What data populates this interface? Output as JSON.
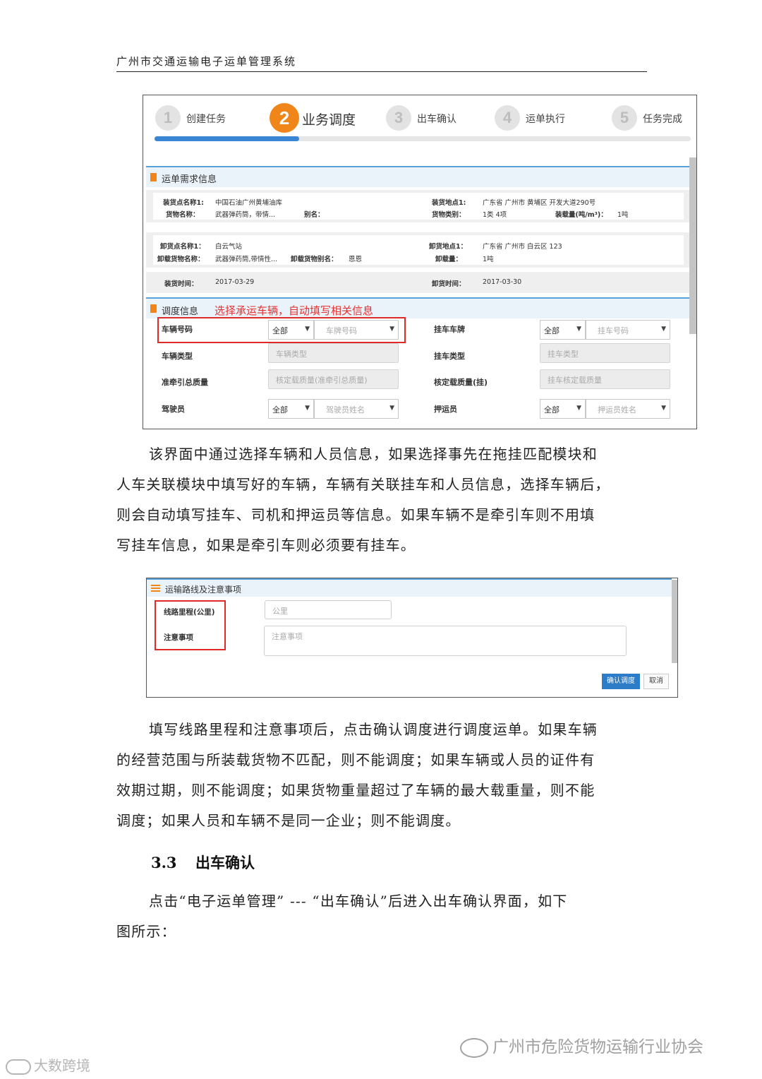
{
  "header": {
    "title": "广州市交通运输电子运单管理系统"
  },
  "screenshot1": {
    "steps": [
      {
        "num": "1",
        "label": "创建任务"
      },
      {
        "num": "2",
        "label": "业务调度"
      },
      {
        "num": "3",
        "label": "出车确认"
      },
      {
        "num": "4",
        "label": "运单执行"
      },
      {
        "num": "5",
        "label": "任务完成"
      }
    ],
    "progress_fraction": 0.27,
    "demand_section_title": "运单需求信息",
    "loading": {
      "name_label": "装货点名称1:",
      "name_value": "中国石油广州黄埔油库",
      "cargo_label": "货物名称：",
      "cargo_value": "武器弹药筒，带情...",
      "alias_label": "别名：",
      "place_label": "装货地点1:",
      "place_value": "广东省 广州市 黄埔区 开发大道290号",
      "type_label": "货物类别：",
      "type_value": "1类 4项",
      "weight_label": "装载量(吨/m³)：",
      "weight_value": "1吨"
    },
    "unloading": {
      "name_label": "卸货点名称1：",
      "name_value": "白云气站",
      "cargo_label": "卸载货物名称：",
      "cargo_value": "武器弹药筒,带情性...",
      "alias_label": "卸载货物别名：",
      "alias_value": "恩恩",
      "place_label": "卸货地点1：",
      "place_value": "广东省 广州市 白云区 123",
      "amount_label": "卸载量：",
      "amount_value": "1吨"
    },
    "times": {
      "load_label": "装货时间：",
      "load_value": "2017-03-29",
      "unload_label": "卸货时间：",
      "unload_value": "2017-03-30"
    },
    "dispatch_section_title": "调度信息",
    "annotation": "选择承运车辆，自动填写相关信息",
    "fields": {
      "vehicle_no_label": "车辆号码",
      "vehicle_scope": "全部",
      "vehicle_placeholder": "车牌号码",
      "trailer_plate_label": "挂车车牌",
      "trailer_scope": "全部",
      "trailer_placeholder": "挂车号码",
      "vehicle_type_label": "车辆类型",
      "vehicle_type_placeholder": "车辆类型",
      "trailer_type_label": "挂车类型",
      "trailer_type_placeholder": "挂车类型",
      "tow_mass_label": "准牵引总质量",
      "tow_mass_placeholder": "核定载质量(准牵引总质量)",
      "rated_load_label": "核定载质量(挂)",
      "rated_load_placeholder": "挂车核定载质量",
      "driver_label": "驾驶员",
      "driver_scope": "全部",
      "driver_placeholder": "驾驶员姓名",
      "escort_label": "押运员",
      "escort_scope": "全部",
      "escort_placeholder": "押运员姓名"
    }
  },
  "paragraph1": [
    "该界面中通过选择车辆和人员信息，如果选择事先在拖挂匹配模块和",
    "人车关联模块中填写好的车辆，车辆有关联挂车和人员信息，选择车辆后，",
    "则会自动填写挂车、司机和押运员等信息。如果车辆不是牵引车则不用填",
    "写挂车信息，如果是牵引车则必须要有挂车。"
  ],
  "screenshot2": {
    "section_title": "运输路线及注意事项",
    "distance_label": "线路里程(公里)",
    "distance_placeholder": "公里",
    "notes_label": "注意事项",
    "notes_placeholder": "注意事项",
    "confirm_button": "确认调度",
    "cancel_button": "取消"
  },
  "paragraph2": [
    "填写线路里程和注意事项后，点击确认调度进行调度运单。如果车辆",
    "的经营范围与所装载货物不匹配，则不能调度；如果车辆或人员的证件有",
    "效期过期，则不能调度；如果货物重量超过了车辆的最大载重量，则不能",
    "调度；如果人员和车辆不是同一企业；则不能调度。"
  ],
  "section": {
    "number": "3.3",
    "title": "出车确认"
  },
  "paragraph3": [
    "点击“电子运单管理” --- “出车确认”后进入出车确认界面，如下",
    "图所示："
  ],
  "watermarks": {
    "association": "广州市危险货物运输行业协会",
    "site": "大数跨境"
  }
}
